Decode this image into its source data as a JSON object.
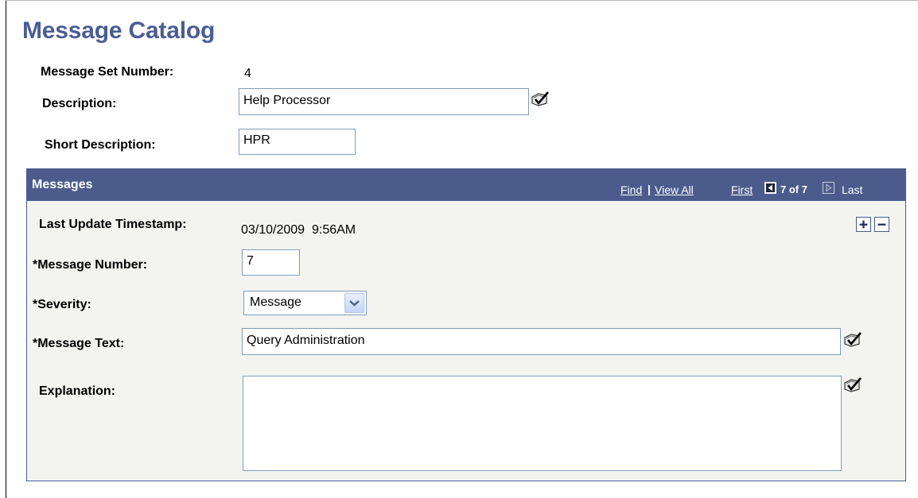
{
  "page": {
    "title": "Message Catalog"
  },
  "header_fields": {
    "set_number_label": "Message Set Number:",
    "set_number_value": "4",
    "description_label": "Description:",
    "description_value": "Help Processor",
    "short_description_label": "Short Description:",
    "short_description_value": "HPR"
  },
  "messages_panel": {
    "title": "Messages",
    "find_link": "Find",
    "separator": "|",
    "view_all_link": "View All",
    "first_link": "First",
    "position": "7 of 7",
    "last_label": "Last",
    "timestamp_label": "Last Update Timestamp:",
    "timestamp_value": "03/10/2009  9:56AM",
    "message_number_label": "*Message Number:",
    "message_number_value": "7",
    "severity_label": "*Severity:",
    "severity_value": "Message",
    "message_text_label": "*Message Text:",
    "message_text_value": "Query Administration",
    "explanation_label": "Explanation:",
    "explanation_value": ""
  },
  "colors": {
    "title": "#4a5d94",
    "panel_header": "#4b5c8c",
    "panel_body": "#f3f4f0",
    "input_border": "#7f9db9"
  },
  "icons": {
    "lookup": "spellcheck-lookup-icon",
    "add_row": "plus-icon",
    "delete_row": "minus-icon",
    "previous": "left-arrow-icon",
    "next": "right-arrow-icon",
    "dropdown": "chevron-down-icon"
  }
}
